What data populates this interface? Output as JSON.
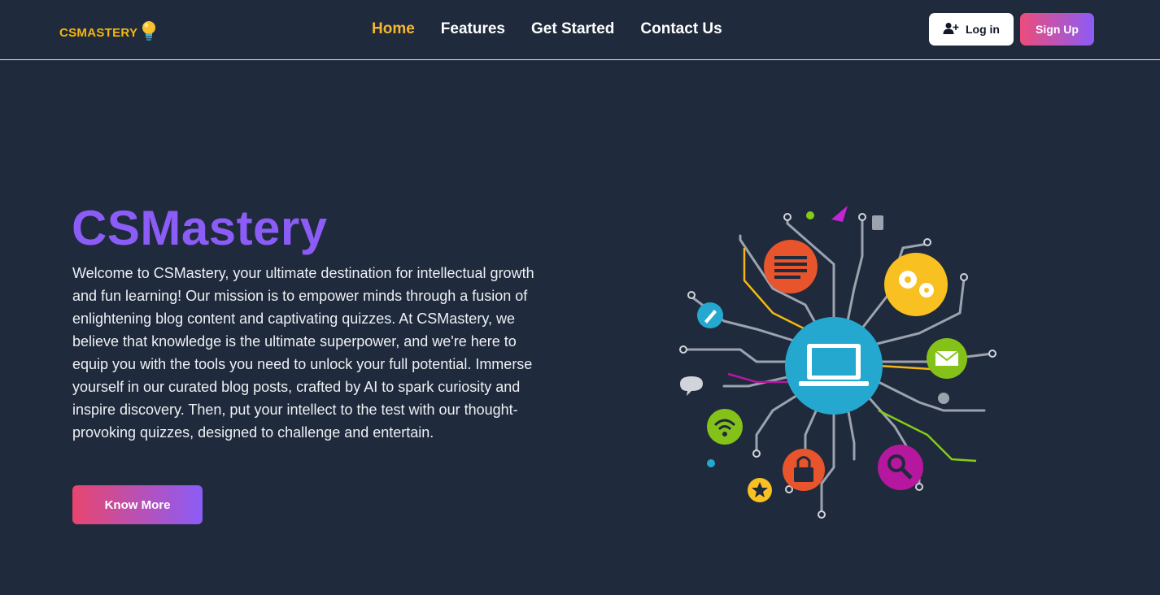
{
  "brand": {
    "name": "CSMASTERY",
    "icon": "lightbulb-icon"
  },
  "nav": {
    "links": [
      {
        "label": "Home",
        "active": true
      },
      {
        "label": "Features",
        "active": false
      },
      {
        "label": "Get Started",
        "active": false
      },
      {
        "label": "Contact Us",
        "active": false
      }
    ]
  },
  "auth": {
    "login_label": "Log in",
    "login_icon": "user-plus-icon",
    "signup_label": "Sign Up"
  },
  "hero": {
    "title": "CSMastery",
    "description": "Welcome to CSMastery, your ultimate destination for intellectual growth and fun learning! Our mission is to empower minds through a fusion of enlightening blog content and captivating quizzes. At CSMastery, we believe that knowledge is the ultimate superpower, and we're here to equip you with the tools you need to unlock your full potential. Immerse yourself in our curated blog posts, crafted by AI to spark curiosity and inspire discovery. Then, put your intellect to the test with our thought-provoking quizzes, designed to challenge and entertain.",
    "cta_label": "Know More"
  },
  "colors": {
    "background": "#1f2a3c",
    "brand_yellow": "#f5b70f",
    "accent_purple": "#8b5cf6",
    "accent_pink": "#ec4c7a"
  }
}
